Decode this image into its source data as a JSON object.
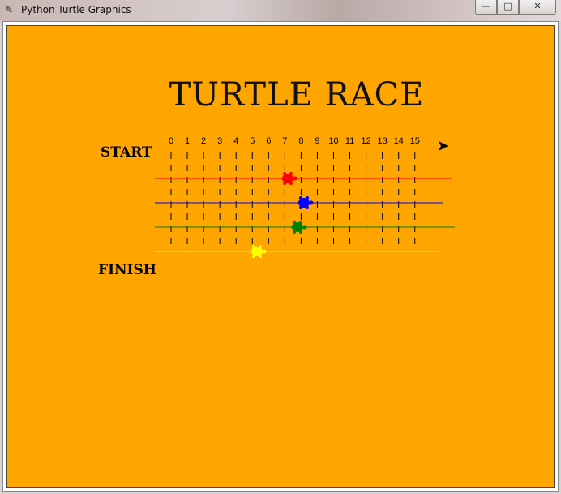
{
  "window": {
    "title": "Python Turtle Graphics",
    "buttons": {
      "minimize": "—",
      "maximize": "□",
      "close": "✕"
    }
  },
  "canvas": {
    "background": "#ffa500",
    "heading": "TURTLE RACE",
    "start_label": "START",
    "finish_label": "FINISH",
    "ticks": [
      "0",
      "1",
      "2",
      "3",
      "4",
      "5",
      "6",
      "7",
      "8",
      "9",
      "10",
      "11",
      "12",
      "13",
      "14",
      "15"
    ]
  },
  "racers": [
    {
      "color": "red",
      "hex": "#ff0000",
      "icon": "turtle-icon"
    },
    {
      "color": "blue",
      "hex": "#0000ff",
      "icon": "turtle-icon"
    },
    {
      "color": "green",
      "hex": "#008000",
      "icon": "turtle-icon"
    },
    {
      "color": "yellow",
      "hex": "#ffff00",
      "icon": "turtle-icon"
    }
  ],
  "pointer_icon": "arrow-cursor-icon"
}
